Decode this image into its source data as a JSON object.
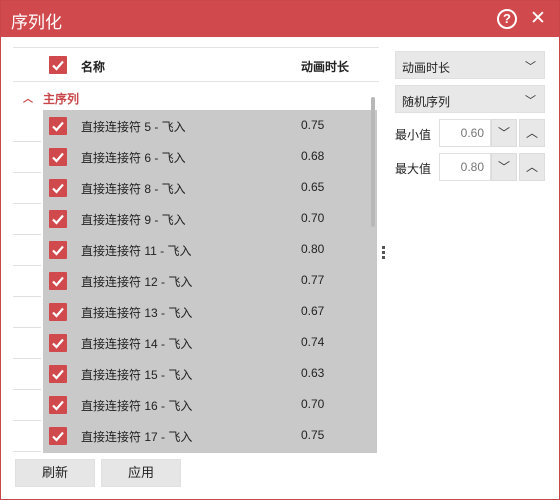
{
  "window": {
    "title": "序列化",
    "help_glyph": "?",
    "close_glyph": "✕"
  },
  "list": {
    "header_name": "名称",
    "header_duration": "动画时长",
    "group_title": "主序列",
    "rows": [
      {
        "name": "直接连接符 5 - 飞入",
        "duration": "0.75"
      },
      {
        "name": "直接连接符 6 - 飞入",
        "duration": "0.68"
      },
      {
        "name": "直接连接符 8 - 飞入",
        "duration": "0.65"
      },
      {
        "name": "直接连接符 9 - 飞入",
        "duration": "0.70"
      },
      {
        "name": "直接连接符 11 - 飞入",
        "duration": "0.80"
      },
      {
        "name": "直接连接符 12 - 飞入",
        "duration": "0.77"
      },
      {
        "name": "直接连接符 13 - 飞入",
        "duration": "0.67"
      },
      {
        "name": "直接连接符 14 - 飞入",
        "duration": "0.74"
      },
      {
        "name": "直接连接符 15 - 飞入",
        "duration": "0.63"
      },
      {
        "name": "直接连接符 16 - 飞入",
        "duration": "0.70"
      },
      {
        "name": "直接连接符 17 - 飞入",
        "duration": "0.75"
      }
    ]
  },
  "settings": {
    "property_dropdown": "动画时长",
    "mode_dropdown": "随机序列",
    "min_label": "最小值",
    "min_value": "0.60",
    "max_label": "最大值",
    "max_value": "0.80"
  },
  "buttons": {
    "refresh": "刷新",
    "apply": "应用"
  },
  "colors": {
    "accent": "#d04a4d",
    "selection": "#c9c9c9"
  },
  "icons": {
    "help": "help-icon",
    "close": "close-icon",
    "check": "check-icon",
    "chevron_down": "chevron-down-icon",
    "chevron_up": "chevron-up-icon",
    "collapse": "collapse-icon"
  }
}
